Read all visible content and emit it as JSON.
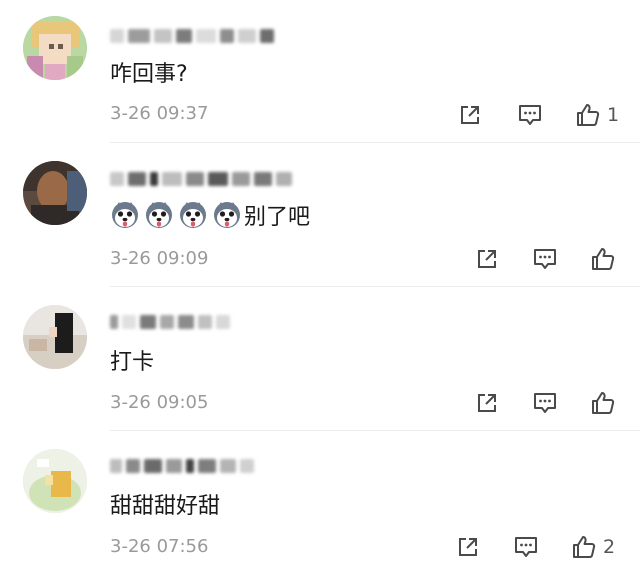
{
  "colors": {
    "text": "#1a1a1a",
    "timestamp": "#9a9a9a",
    "icon": "#4a4a4a",
    "divider": "#ececec"
  },
  "comments": [
    {
      "content": "咋回事?",
      "emojis": [],
      "timestamp": "3-26 09:37",
      "like_count": "1",
      "username_redacted": true,
      "avatar_icon": "cartoon-avatar"
    },
    {
      "content": "别了吧",
      "emojis": [
        "husky-dog-emoji",
        "husky-dog-emoji",
        "husky-dog-emoji",
        "husky-dog-emoji"
      ],
      "timestamp": "3-26 09:09",
      "like_count": "",
      "username_redacted": true,
      "avatar_icon": "photo-avatar"
    },
    {
      "content": "打卡",
      "emojis": [],
      "timestamp": "3-26 09:05",
      "like_count": "",
      "username_redacted": true,
      "avatar_icon": "photo-avatar"
    },
    {
      "content": "甜甜甜好甜",
      "emojis": [],
      "timestamp": "3-26 07:56",
      "like_count": "2",
      "username_redacted": true,
      "avatar_icon": "cartoon-avatar"
    }
  ],
  "icons": {
    "share": "share-icon",
    "reply": "comment-icon",
    "like": "thumbs-up-icon"
  }
}
